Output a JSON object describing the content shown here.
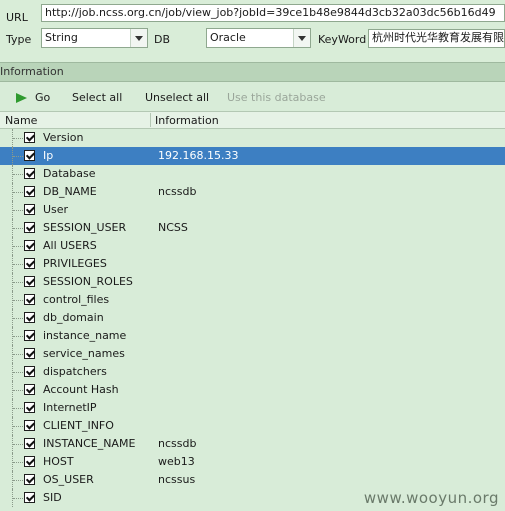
{
  "form": {
    "url_label": "URL",
    "url_value": "http://job.ncss.org.cn/job/view_job?jobId=39ce1b48e9844d3cb32a03dc56b16d49",
    "type_label": "Type",
    "type_value": "String",
    "db_label": "DB",
    "db_value": "Oracle",
    "keyword_label": "KeyWord",
    "keyword_value": "杭州时代光华教育发展有限"
  },
  "section_title": "Information",
  "toolbar": {
    "go": "Go",
    "select_all": "Select all",
    "unselect_all": "Unselect all",
    "use_db": "Use this database"
  },
  "grid": {
    "col_name": "Name",
    "col_info": "Information",
    "rows": [
      {
        "name": "Version",
        "info": ""
      },
      {
        "name": "Ip",
        "info": "192.168.15.33",
        "selected": true
      },
      {
        "name": "Database",
        "info": ""
      },
      {
        "name": "DB_NAME",
        "info": "ncssdb"
      },
      {
        "name": "User",
        "info": ""
      },
      {
        "name": "SESSION_USER",
        "info": "NCSS"
      },
      {
        "name": "All USERS",
        "info": ""
      },
      {
        "name": "PRIVILEGES",
        "info": ""
      },
      {
        "name": "SESSION_ROLES",
        "info": ""
      },
      {
        "name": "control_files",
        "info": ""
      },
      {
        "name": "db_domain",
        "info": ""
      },
      {
        "name": "instance_name",
        "info": ""
      },
      {
        "name": "service_names",
        "info": ""
      },
      {
        "name": "dispatchers",
        "info": ""
      },
      {
        "name": "Account Hash",
        "info": ""
      },
      {
        "name": "InternetIP",
        "info": ""
      },
      {
        "name": "CLIENT_INFO",
        "info": ""
      },
      {
        "name": "INSTANCE_NAME",
        "info": "ncssdb"
      },
      {
        "name": "HOST",
        "info": "web13"
      },
      {
        "name": "OS_USER",
        "info": "ncssus"
      },
      {
        "name": "SID",
        "info": ""
      }
    ]
  },
  "watermark": "www.wooyun.org",
  "colors": {
    "background": "#d8ecd8",
    "selection": "#3d7fc2",
    "go_icon": "#2e9a2e"
  }
}
